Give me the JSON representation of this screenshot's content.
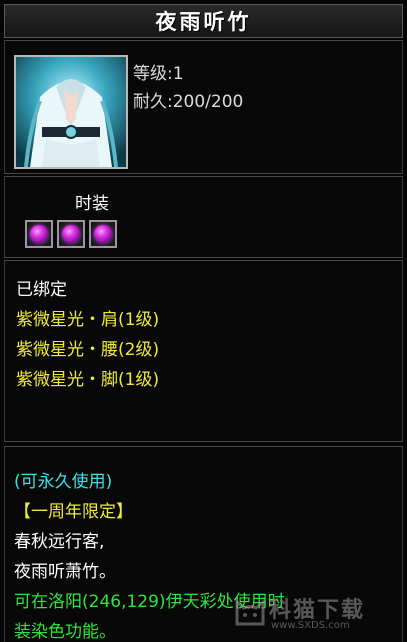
{
  "item": {
    "name": "夜雨听竹",
    "level_text": "等级:1",
    "durability_text": "耐久:200/200"
  },
  "fashion": {
    "label": "时装",
    "gems": [
      {
        "icon": "purple-gem-icon",
        "color": "#d633e0"
      },
      {
        "icon": "purple-gem-icon",
        "color": "#d633e0"
      },
      {
        "icon": "purple-gem-icon",
        "color": "#d633e0"
      }
    ]
  },
  "binding": {
    "status": "已绑定",
    "set_pieces": [
      "紫微星光・肩(1级)",
      "紫微星光・腰(2级)",
      "紫微星光・脚(1级)"
    ]
  },
  "description": {
    "permanent": "(可永久使用)",
    "limited": "【一周年限定】",
    "poem_line1": "春秋远行客,",
    "poem_line2": "夜雨听萧竹。",
    "usage_line1": "可在洛阳(246,129)伊天彩处使用时",
    "usage_line2": "装染色功能。"
  },
  "watermark": {
    "text": "科猫下载",
    "url": "www.SXDS.com"
  },
  "colors": {
    "yellow": "#f2ec39",
    "cyan": "#3ee0e6",
    "green": "#2ee53a"
  }
}
